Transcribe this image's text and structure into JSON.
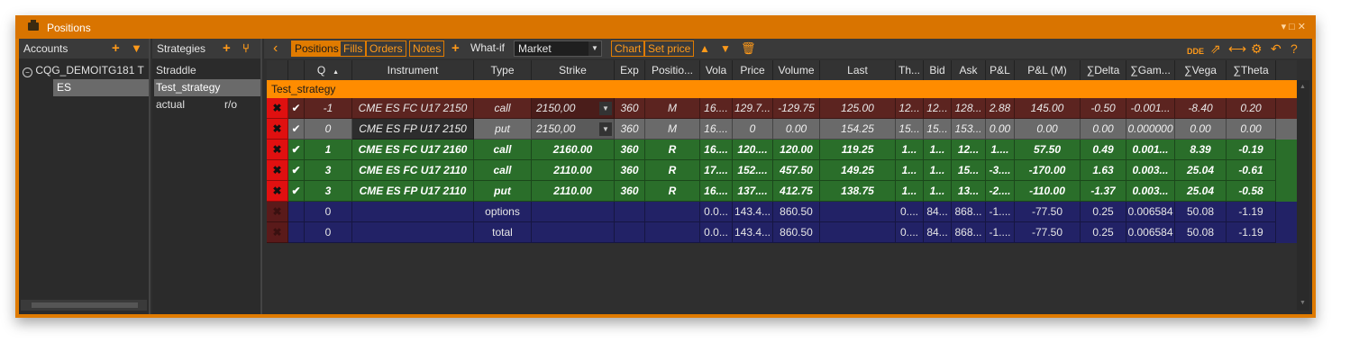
{
  "window": {
    "title": "Positions",
    "controls": "▾□✕"
  },
  "accounts": {
    "header": "Accounts",
    "items": [
      {
        "label": "CQG_DEMOITG181 T"
      },
      {
        "label": "ES"
      }
    ]
  },
  "strategies": {
    "header": "Strategies",
    "items": [
      {
        "label": "Straddle"
      },
      {
        "label": "Test_strategy"
      },
      {
        "label": "actual"
      }
    ],
    "actual_suffix": "r/o"
  },
  "toolbar": {
    "tabs": [
      "Positions",
      "Fills",
      "Orders",
      "Notes"
    ],
    "whatif_label": "What-if",
    "whatif_value": "Market",
    "chart": "Chart",
    "set_price": "Set price",
    "dde": "DDE"
  },
  "columns": [
    "",
    "",
    "Q",
    "Instrument",
    "Type",
    "Strike",
    "Exp",
    "Positio...",
    "Vola",
    "Price",
    "Volume",
    "Last",
    "Th...",
    "Bid",
    "Ask",
    "P&L",
    "P&L (M)",
    "∑Delta",
    "∑Gam...",
    "∑Vega",
    "∑Theta"
  ],
  "group": "Test_strategy",
  "rows": [
    {
      "style": "dark",
      "x": "✖",
      "check": "✔",
      "q": "-1",
      "instrument": "CME ES FC U17 2150",
      "type": "call",
      "strike": "2150,00",
      "exp": "360",
      "pos": "M",
      "vola": "16....",
      "price": "129.7...",
      "volume": "-129.75",
      "last": "125.00",
      "th": "12...",
      "bid": "12...",
      "ask": "128...",
      "pl": "2.88",
      "plm": "145.00",
      "delta": "-0.50",
      "gamma": "-0.001...",
      "vega": "-8.40",
      "theta": "0.20"
    },
    {
      "style": "grey",
      "x": "✖",
      "check": "✔",
      "q": "0",
      "instrument": "CME ES FP U17 2150",
      "type": "put",
      "strike": "2150,00",
      "exp": "360",
      "pos": "M",
      "vola": "16....",
      "price": "0",
      "volume": "0.00",
      "last": "154.25",
      "th": "15...",
      "bid": "15...",
      "ask": "153...",
      "pl": "0.00",
      "plm": "0.00",
      "delta": "0.00",
      "gamma": "0.000000",
      "vega": "0.00",
      "theta": "0.00"
    },
    {
      "style": "green",
      "x": "✖",
      "check": "✔",
      "q": "1",
      "instrument": "CME ES FC U17 2160",
      "type": "call",
      "strike": "2160.00",
      "exp": "360",
      "pos": "R",
      "vola": "16....",
      "price": "120....",
      "volume": "120.00",
      "last": "119.25",
      "th": "1...",
      "bid": "1...",
      "ask": "12...",
      "pl": "1....",
      "plm": "57.50",
      "delta": "0.49",
      "gamma": "0.001...",
      "vega": "8.39",
      "theta": "-0.19"
    },
    {
      "style": "green",
      "x": "✖",
      "check": "✔",
      "q": "3",
      "instrument": "CME ES FC U17 2110",
      "type": "call",
      "strike": "2110.00",
      "exp": "360",
      "pos": "R",
      "vola": "17....",
      "price": "152....",
      "volume": "457.50",
      "last": "149.25",
      "th": "1...",
      "bid": "1...",
      "ask": "15...",
      "pl": "-3....",
      "plm": "-170.00",
      "delta": "1.63",
      "gamma": "0.003...",
      "vega": "25.04",
      "theta": "-0.61"
    },
    {
      "style": "green",
      "x": "✖",
      "check": "✔",
      "q": "3",
      "instrument": "CME ES FP U17 2110",
      "type": "put",
      "strike": "2110.00",
      "exp": "360",
      "pos": "R",
      "vola": "16....",
      "price": "137....",
      "volume": "412.75",
      "last": "138.75",
      "th": "1...",
      "bid": "1...",
      "ask": "13...",
      "pl": "-2....",
      "plm": "-110.00",
      "delta": "-1.37",
      "gamma": "0.003...",
      "vega": "25.04",
      "theta": "-0.58"
    },
    {
      "style": "blue",
      "x": "✖",
      "check": "",
      "q": "0",
      "instrument": "",
      "type": "options",
      "strike": "",
      "exp": "",
      "pos": "",
      "vola": "0.0...",
      "price": "143.4...",
      "volume": "860.50",
      "last": "",
      "th": "0....",
      "bid": "84...",
      "ask": "868...",
      "pl": "-1....",
      "plm": "-77.50",
      "delta": "0.25",
      "gamma": "0.006584",
      "vega": "50.08",
      "theta": "-1.19"
    },
    {
      "style": "blue",
      "x": "✖",
      "check": "",
      "q": "0",
      "instrument": "",
      "type": "total",
      "strike": "",
      "exp": "",
      "pos": "",
      "vola": "0.0...",
      "price": "143.4...",
      "volume": "860.50",
      "last": "",
      "th": "0....",
      "bid": "84...",
      "ask": "868...",
      "pl": "-1....",
      "plm": "-77.50",
      "delta": "0.25",
      "gamma": "0.006584",
      "vega": "50.08",
      "theta": "-1.19"
    }
  ]
}
